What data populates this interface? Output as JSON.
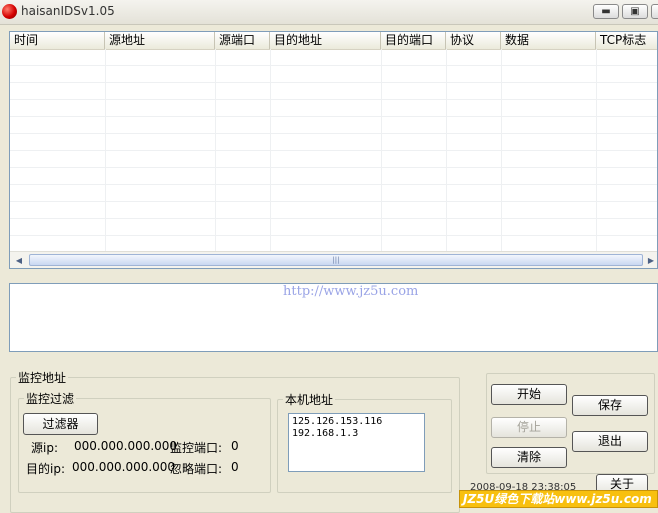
{
  "window": {
    "title": "haisanIDSv1.05"
  },
  "table": {
    "columns": [
      "时间",
      "源地址",
      "源端口",
      "目的地址",
      "目的端口",
      "协议",
      "数据",
      "TCP标志"
    ]
  },
  "log": {
    "watermark_text": "http://www.jz5u.com"
  },
  "monitor": {
    "group_label": "监控地址",
    "filter": {
      "group_label": "监控过滤",
      "button_label": "过滤器",
      "src_ip_label": "源ip:",
      "src_ip_value": "000.000.000.000",
      "monitor_port_label": "监控端口:",
      "monitor_port_value": "0",
      "dst_ip_label": "目的ip:",
      "dst_ip_value": "000.000.000.000",
      "ignore_port_label": "忽略端口:",
      "ignore_port_value": "0"
    },
    "local": {
      "group_label": "本机地址",
      "addresses": [
        "125.126.153.116",
        "192.168.1.3"
      ]
    }
  },
  "controls": {
    "start": "开始",
    "stop": "停止",
    "clear": "清除",
    "save": "保存",
    "exit": "退出",
    "about": "关于"
  },
  "status": {
    "datetime": "2008-09-18 23:38:05"
  },
  "footer_watermark": "JZ5U绿色下载站www.jz5u.com"
}
